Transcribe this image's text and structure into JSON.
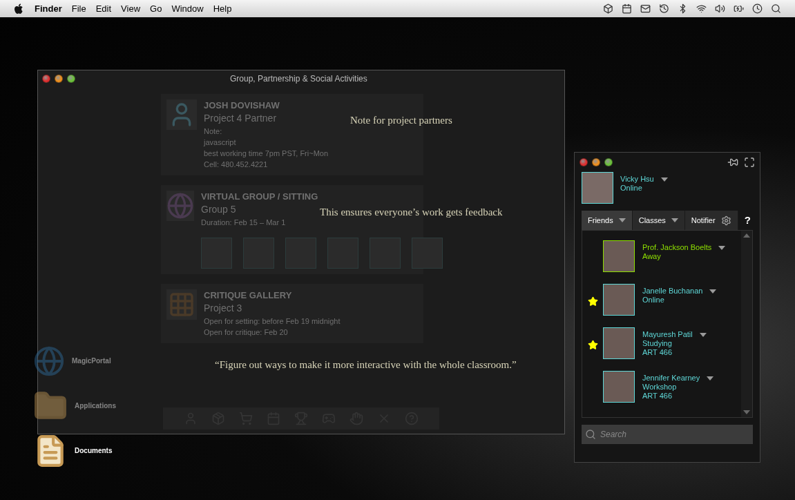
{
  "menu_bar": {
    "app": "Finder",
    "items": [
      "File",
      "Edit",
      "View",
      "Go",
      "Window",
      "Help"
    ]
  },
  "desktop_icons": [
    {
      "label": "MagicPortal",
      "kind": "portal",
      "dimmed": true
    },
    {
      "label": "Applications",
      "kind": "folder",
      "dimmed": true
    },
    {
      "label": "Documents",
      "kind": "documents",
      "dimmed": false
    }
  ],
  "main_window": {
    "title": "Group, Partnership & Social Activities",
    "cards": [
      {
        "kind": "partner",
        "heading": "JOSH DOVISHAW",
        "subheading": "Project 4 Partner",
        "lines": [
          "Note:",
          "javascript",
          "best working time 7pm PST, Fri~Mon",
          "Cell: 480.452.4221"
        ]
      },
      {
        "kind": "group",
        "heading": "VIRTUAL GROUP / SITTING",
        "subheading": "Group 5",
        "lines": [
          "Duration: Feb 15 – Mar 1"
        ]
      },
      {
        "kind": "gallery",
        "heading": "CRITIQUE GALLERY",
        "subheading": "Project 3",
        "lines": [
          "Open for setting: before Feb 19 midnight",
          "Open for critique: Feb 20"
        ]
      }
    ],
    "notes": [
      "Note for project partners",
      "This ensures everyone’s work gets feedback",
      "“Figure out ways to make it more interactive with the whole classroom.”"
    ]
  },
  "buddy_panel": {
    "user": {
      "name": "Vicky Hsu",
      "status": "Online"
    },
    "tabs": [
      {
        "label": "Friends",
        "selected": true
      },
      {
        "label": "Classes",
        "selected": false
      },
      {
        "label": "Notifier",
        "selected": false
      }
    ],
    "help": "?",
    "friends": [
      {
        "name": "Prof. Jackson Boelts",
        "status": "Away",
        "starred": false,
        "color": "#8ee000"
      },
      {
        "name": "Janelle Buchanan",
        "status": "Online",
        "starred": true,
        "color": "#5fd8d8"
      },
      {
        "name": "Mayuresh Patil",
        "status": "Studying",
        "course": "ART 466",
        "starred": true,
        "color": "#5fd8d8"
      },
      {
        "name": "Jennifer Kearney",
        "status": "Workshop",
        "course": "ART 466",
        "starred": false,
        "color": "#5fd8d8"
      }
    ],
    "search": {
      "placeholder": "Search"
    }
  }
}
